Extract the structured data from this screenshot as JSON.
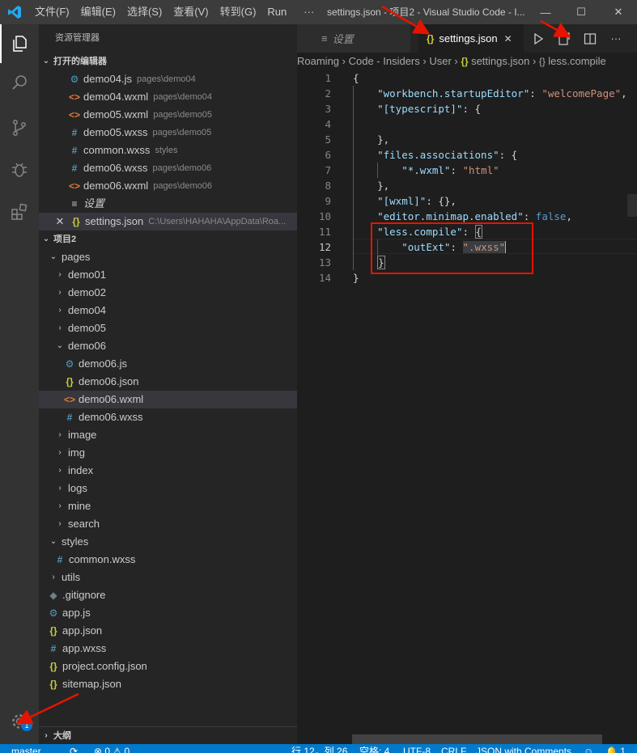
{
  "titlebar": {
    "menu": [
      "文件(F)",
      "编辑(E)",
      "选择(S)",
      "查看(V)",
      "转到(G)",
      "Run",
      "···"
    ],
    "title": "settings.json - 项目2 - Visual Studio Code - I...",
    "minimize": "—",
    "maximize": "☐",
    "close": "✕"
  },
  "sidebar": {
    "title": "资源管理器",
    "open_editors": {
      "heading": "打开的编辑器",
      "items": [
        {
          "icon": "⚙",
          "name": "demo04.js",
          "desc": "pages\\demo04"
        },
        {
          "icon": "<>",
          "name": "demo04.wxml",
          "desc": "pages\\demo04"
        },
        {
          "icon": "<>",
          "name": "demo05.wxml",
          "desc": "pages\\demo05"
        },
        {
          "icon": "#",
          "name": "demo05.wxss",
          "desc": "pages\\demo05"
        },
        {
          "icon": "#",
          "name": "common.wxss",
          "desc": "styles"
        },
        {
          "icon": "#",
          "name": "demo06.wxss",
          "desc": "pages\\demo06"
        },
        {
          "icon": "<>",
          "name": "demo06.wxml",
          "desc": "pages\\demo06"
        },
        {
          "icon": "≡",
          "name": "设置",
          "desc": ""
        },
        {
          "icon": "{}",
          "name": "settings.json",
          "desc": "C:\\Users\\HAHAHA\\AppData\\Roa..."
        }
      ]
    },
    "project": {
      "heading": "项目2",
      "tree": [
        {
          "label": "pages",
          "chev": "⌄"
        },
        {
          "label": "demo01",
          "chev": "›"
        },
        {
          "label": "demo02",
          "chev": "›"
        },
        {
          "label": "demo04",
          "chev": "›"
        },
        {
          "label": "demo05",
          "chev": "›"
        },
        {
          "label": "demo06",
          "chev": "⌄"
        },
        {
          "label": "demo06.js",
          "icon": "⚙"
        },
        {
          "label": "demo06.json",
          "icon": "{}"
        },
        {
          "label": "demo06.wxml",
          "icon": "<>"
        },
        {
          "label": "demo06.wxss",
          "icon": "#"
        },
        {
          "label": "image",
          "chev": "›"
        },
        {
          "label": "img",
          "chev": "›"
        },
        {
          "label": "index",
          "chev": "›"
        },
        {
          "label": "logs",
          "chev": "›"
        },
        {
          "label": "mine",
          "chev": "›"
        },
        {
          "label": "search",
          "chev": "›"
        },
        {
          "label": "styles",
          "chev": "⌄"
        },
        {
          "label": "common.wxss",
          "icon": "#"
        },
        {
          "label": "utils",
          "chev": "›"
        },
        {
          "label": ".gitignore",
          "icon": "◆"
        },
        {
          "label": "app.js",
          "icon": "⚙"
        },
        {
          "label": "app.json",
          "icon": "{}"
        },
        {
          "label": "app.wxss",
          "icon": "#"
        },
        {
          "label": "project.config.json",
          "icon": "{}"
        },
        {
          "label": "sitemap.json",
          "icon": "{}"
        }
      ]
    },
    "outline": "大纲"
  },
  "tabs": {
    "settings_ui": "设置",
    "settings_json": "settings.json",
    "close": "✕"
  },
  "breadcrumb": [
    "Roaming",
    "Code - Insiders",
    "User",
    "settings.json",
    "less.compile"
  ],
  "code": {
    "line_numbers": [
      "1",
      "2",
      "3",
      "4",
      "5",
      "6",
      "7",
      "8",
      "9",
      "10",
      "11",
      "12",
      "13",
      "14"
    ]
  },
  "activity": {
    "settings_badge": "1"
  },
  "status": {
    "branch": "master",
    "sync": "⟳",
    "problems": "⊗ 0  ⚠ 0",
    "position": "行 12，列 26",
    "spaces": "空格: 4",
    "encoding": "UTF-8",
    "eol": "CRLF",
    "language": "JSON with Comments",
    "feedback": "☺",
    "bell": "🔔 1"
  },
  "colors": {
    "accent": "#007acc",
    "annotation_red": "#e51400"
  }
}
